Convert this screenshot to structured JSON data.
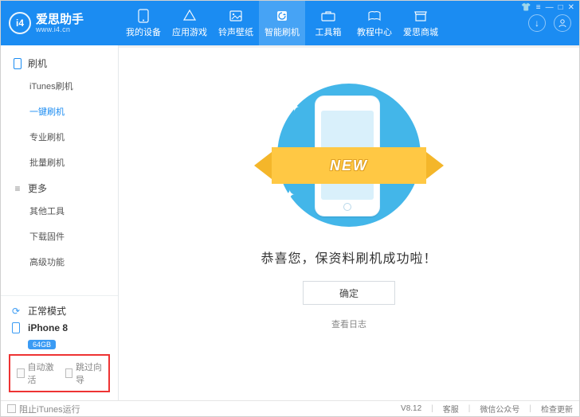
{
  "app": {
    "name": "爱思助手",
    "url": "www.i4.cn",
    "logo_text": "i4"
  },
  "nav": [
    {
      "label": "我的设备",
      "icon": "phone-icon"
    },
    {
      "label": "应用游戏",
      "icon": "apps-icon"
    },
    {
      "label": "铃声壁纸",
      "icon": "image-icon"
    },
    {
      "label": "智能刷机",
      "icon": "flash-icon",
      "active": true
    },
    {
      "label": "工具箱",
      "icon": "toolbox-icon"
    },
    {
      "label": "教程中心",
      "icon": "book-icon"
    },
    {
      "label": "爱思商城",
      "icon": "store-icon"
    }
  ],
  "sidebar": {
    "groups": [
      {
        "icon": "phone-icon",
        "label": "刷机",
        "items": [
          {
            "label": "iTunes刷机"
          },
          {
            "label": "一键刷机",
            "active": true
          },
          {
            "label": "专业刷机"
          },
          {
            "label": "批量刷机"
          }
        ]
      },
      {
        "icon": "list-icon",
        "label": "更多",
        "items": [
          {
            "label": "其他工具"
          },
          {
            "label": "下载固件"
          },
          {
            "label": "高级功能"
          }
        ]
      }
    ]
  },
  "device": {
    "mode": "正常模式",
    "name": "iPhone 8",
    "capacity": "64GB"
  },
  "options": {
    "auto_activate": "自动激活",
    "skip_wizard": "跳过向导"
  },
  "main": {
    "ribbon": "NEW",
    "success_msg": "恭喜您，保资料刷机成功啦！",
    "ok_button": "确定",
    "view_log": "查看日志"
  },
  "status": {
    "block_itunes": "阻止iTunes运行",
    "version": "V8.12",
    "support": "客服",
    "wechat": "微信公众号",
    "check_update": "检查更新"
  }
}
